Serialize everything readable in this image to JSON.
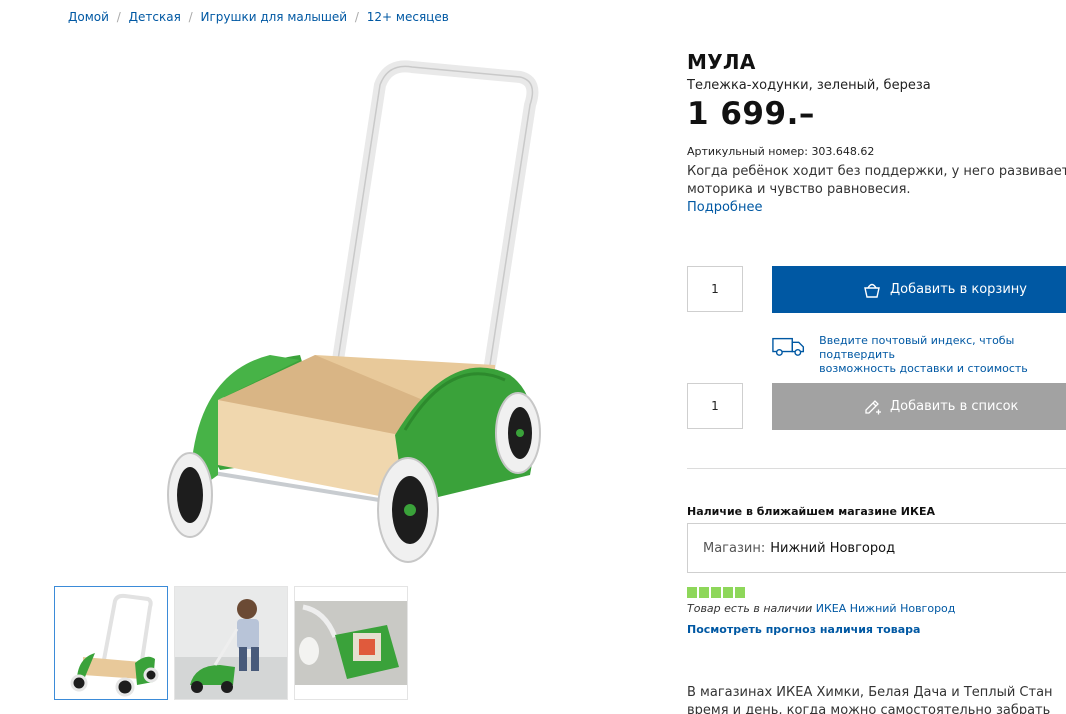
{
  "breadcrumb": {
    "items": [
      "Домой",
      "Детская",
      "Игрушки для малышей",
      "12+ месяцев"
    ],
    "separator": "/"
  },
  "product": {
    "name": "МУЛА",
    "description": "Тележка-ходунки, зеленый, береза",
    "price": "1 699.–",
    "article_label": "Артикульный номер:",
    "article_number": "303.648.62",
    "summary": "Когда ребёнок ходит без поддержки, у него развивается\nмоторика и чувство равновесия.",
    "more_link": "Подробнее"
  },
  "purchase": {
    "qty_cart": "1",
    "add_to_cart_label": "Добавить в корзину",
    "delivery_text": "Введите почтовый индекс, чтобы подтвердить\nвозможность доставки и стоимость",
    "qty_list": "1",
    "add_to_list_label": "Добавить в список"
  },
  "availability": {
    "title": "Наличие в ближайшем магазине ИКЕА",
    "store_label": "Магазин:",
    "store_value": "Нижний Новгород",
    "stock_level": 5,
    "stock_max": 5,
    "stock_text": "Товар есть в наличии",
    "stock_store_link": "ИКЕА Нижний Новгород",
    "forecast_link": "Посмотреть прогноз наличия товара"
  },
  "pickup": {
    "text": "В магазинах ИКЕА Химки, Белая Дача и Теплый Стан\nвремя и день, когда можно самостоятельно забрать"
  },
  "colors": {
    "accent_blue": "#0058a3",
    "button_gray": "#a2a2a2",
    "stock_green": "#8ed75a",
    "product_green": "#3aa23a"
  },
  "icons": {
    "cart": "basket-icon",
    "list": "pencil-list-icon",
    "delivery": "truck-icon"
  }
}
